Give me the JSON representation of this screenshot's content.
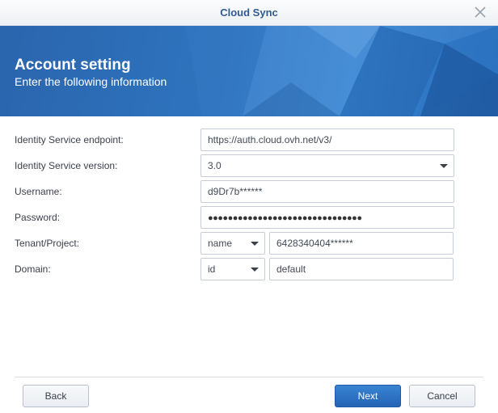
{
  "window": {
    "title": "Cloud Sync"
  },
  "banner": {
    "title": "Account setting",
    "subtitle": "Enter the following information"
  },
  "form": {
    "endpoint": {
      "label": "Identity Service endpoint:",
      "value": "https://auth.cloud.ovh.net/v3/"
    },
    "version": {
      "label": "Identity Service version:",
      "value": "3.0"
    },
    "username": {
      "label": "Username:",
      "value": "d9Dr7b******"
    },
    "password": {
      "label": "Password:",
      "value": "●●●●●●●●●●●●●●●●●●●●●●●●●●●●●●●"
    },
    "tenant": {
      "label": "Tenant/Project:",
      "type_value": "name",
      "value": "6428340404******"
    },
    "domain": {
      "label": "Domain:",
      "type_value": "id",
      "value": "default"
    }
  },
  "footer": {
    "back": "Back",
    "next": "Next",
    "cancel": "Cancel"
  },
  "colors": {
    "accent": "#2d5c93",
    "banner": "#2f74bf",
    "primary_button": "#2a6cbd"
  }
}
